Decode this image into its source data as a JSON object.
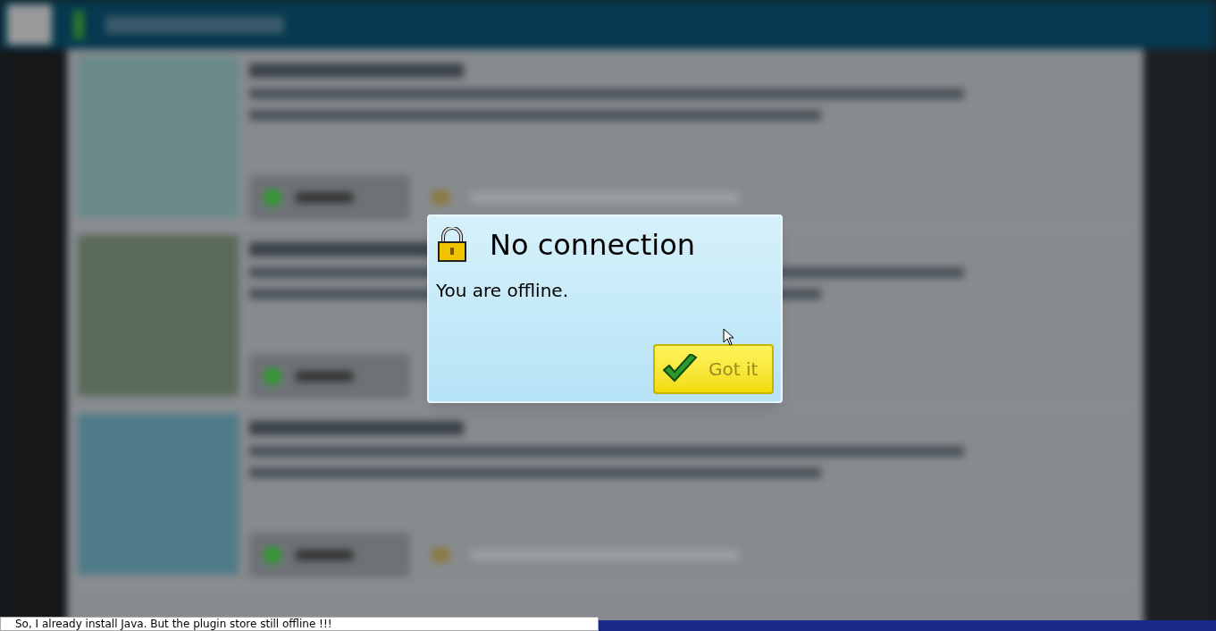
{
  "dialog": {
    "title": "No connection",
    "message": "You are offline.",
    "button": {
      "label": "Got it"
    }
  },
  "comment_box": {
    "value": "So, I already install Java. But the plugin store still offline !!!"
  }
}
